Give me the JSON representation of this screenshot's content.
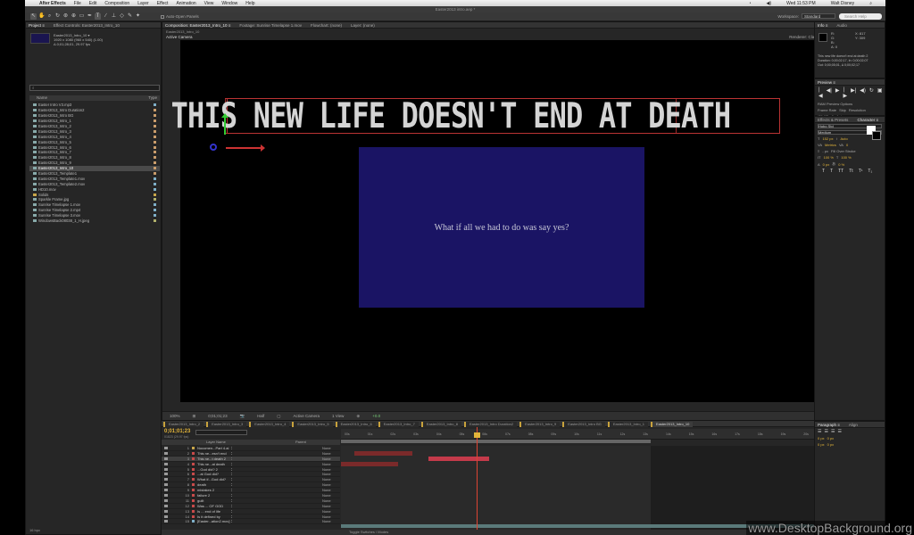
{
  "menubar": {
    "items": [
      "After Effects",
      "File",
      "Edit",
      "Composition",
      "Layer",
      "Effect",
      "Animation",
      "View",
      "Window",
      "Help"
    ],
    "clock": "Wed 11:53 PM",
    "user": "Walt Disney"
  },
  "window": {
    "title": "Easter2013 intro.aep *"
  },
  "toolbar": {
    "auto_open_label": "Auto-Open Panels",
    "workspace_label": "Workspace:",
    "workspace_value": "Standard",
    "help_placeholder": "Search Help"
  },
  "project": {
    "tabs": [
      "Project ≡",
      "Effect Controls: Easter2013_Intro_10"
    ],
    "selected_name": "Easter2013_Intro_10 ▾",
    "selected_info": "1920 x 1080 (960 x 540) (1.00)\nΔ 0;01;28;01, 29.97 fps",
    "column_name": "Name",
    "column_type": "Type",
    "items": [
      {
        "name": "Easter Intro V3.mp3",
        "label": "#7fb0c9"
      },
      {
        "name": "Easter2013_Intro Duration2",
        "label": "#c99c6b"
      },
      {
        "name": "Easter2013_Intro BG",
        "label": "#c99c6b"
      },
      {
        "name": "Easter2013_Intro_1",
        "label": "#c99c6b"
      },
      {
        "name": "Easter2013_Intro_2",
        "label": "#c99c6b"
      },
      {
        "name": "Easter2013_Intro_3",
        "label": "#c99c6b"
      },
      {
        "name": "Easter2013_Intro_4",
        "label": "#c99c6b"
      },
      {
        "name": "Easter2013_Intro_5",
        "label": "#c99c6b"
      },
      {
        "name": "Easter2013_Intro_6",
        "label": "#c99c6b"
      },
      {
        "name": "Easter2013_Intro_7",
        "label": "#c99c6b"
      },
      {
        "name": "Easter2013_Intro_8",
        "label": "#c99c6b"
      },
      {
        "name": "Easter2013_Intro_9",
        "label": "#c99c6b"
      },
      {
        "name": "Easter2013_Intro_10",
        "label": "#c99c6b",
        "selected": true
      },
      {
        "name": "Easter2013_Template1",
        "label": "#c99c6b"
      },
      {
        "name": "Easter2013_Template1.mov",
        "label": "#7fb0c9"
      },
      {
        "name": "Easter2013_Template2.mov",
        "label": "#7fb0c9"
      },
      {
        "name": "HD10.mov",
        "label": "#7fb0c9"
      },
      {
        "name": "Solids",
        "label": "#c9a64a",
        "folder": true
      },
      {
        "name": "Sparkle Frame.jpg",
        "label": "#b0b06b"
      },
      {
        "name": "Sunrise Timelapse 1.mov",
        "label": "#7fb0c9"
      },
      {
        "name": "Sunrise Timelapse 2.mp4",
        "label": "#7fb0c9"
      },
      {
        "name": "Sunrise Timelapse 3.mov",
        "label": "#7fb0c9"
      },
      {
        "name": "WindowsBack08038_1_H.jpeg",
        "label": "#b0b06b"
      }
    ],
    "footer_bpc": "16 bpc"
  },
  "composition": {
    "tabs": [
      "Composition: Easter2013_Intro_10 ≡",
      "Footage: Sunrise Timelapse 1.mov",
      "Flowchart: (none)",
      "Layer: (none)"
    ],
    "crumb": "Easter2013_Intro_10",
    "active_camera": "Active Camera",
    "renderer": "Renderer:  Classic 3D",
    "headline": "THIS NEW LIFE DOESN'T END AT DEATH",
    "slide_text": "What if all we had to do was say yes?",
    "slide_color": "#1a1464",
    "footer": [
      "100%",
      "⊞",
      "0;01;01;23",
      "📷",
      "Half",
      "▢",
      "Active Camera",
      "1 View",
      "⊕",
      "+0.0"
    ]
  },
  "info": {
    "tabs": [
      "Info ≡",
      "Audio"
    ],
    "values": "R:\nG:\nB:\nA: 0",
    "coords": "X: 817\nY: 309",
    "note": "This new life doesn't end at death 2\nDuration: 0;00;02;17, In: 0;00;02;07\nOut: 0;00;05;01, Δ 0;00;02;17"
  },
  "preview": {
    "title": "Preview ≡",
    "transport": [
      "|◀",
      "◀|",
      "▶",
      "|▶",
      "▶|",
      "◀)",
      "↻",
      "▣"
    ],
    "ram_options": "RAM Preview Options",
    "frame_rate_label": "Frame Rate",
    "skip_label": "Skip",
    "resolution_label": "Resolution",
    "frame_rate": "(29.97)",
    "skip": "0",
    "resolution": "Auto",
    "from_current": "From Current Time",
    "full_screen": "Full Screen"
  },
  "character": {
    "tabs": [
      "Effects & Presets",
      "Character ≡"
    ],
    "font": "Hobo Std",
    "style": "Medium",
    "size": "152 px",
    "auto": "Auto",
    "metrics": "Metrics",
    "tracking": "0",
    "stroke": "- px",
    "stroke_mode": "Fill Over Stroke",
    "vscale": "100 %",
    "hscale": "100 %",
    "baseline": "0 px",
    "tsume": "0 %"
  },
  "paragraph": {
    "tabs": [
      "Paragraph ≡",
      "Align"
    ],
    "indent_l": "0 px",
    "indent_r": "0 px",
    "space_before": "0 px",
    "space_after": "0 px"
  },
  "timeline": {
    "tabs": [
      "Easter2013_Intro_2",
      "Easter2013_Intro_3",
      "Easter2013_Intro_4",
      "Easter2013_Intro_5",
      "Easter2013_Intro_6",
      "Easter2013_Intro_7",
      "Easter2013_Intro_8",
      "Easter2013_Intro Duration2",
      "Easter2013_Intro_9",
      "Easter2013_Intro BG",
      "Easter2013_Intro_1",
      "Easter2013_Intro_10"
    ],
    "active_tab": 11,
    "timecode": "0;01;01;23",
    "fps_note": "01823 (29.97 fps)",
    "header_name": "Layer Name",
    "header_parent": "Parent",
    "ruler": [
      "00s",
      "01s",
      "02s",
      "03s",
      "04s",
      "05s",
      "06s",
      "07s",
      "08s",
      "09s",
      "10s",
      "11s",
      "12s",
      "13s",
      "14s",
      "15s",
      "16s",
      "17s",
      "18s",
      "19s",
      "20s",
      "21s"
    ],
    "layers": [
      {
        "num": "1",
        "name": "Nocomen...Part 4.ai",
        "color": "#c9a64a",
        "parent": "None"
      },
      {
        "num": "2",
        "name": "This ne...esn't end",
        "color": "#c84a4a",
        "parent": "None"
      },
      {
        "num": "3",
        "name": "This ne...t death 2",
        "color": "#c84a4a",
        "parent": "None",
        "selected": true
      },
      {
        "num": "4",
        "name": "This ne...at death",
        "color": "#c84a4a",
        "parent": "None"
      },
      {
        "num": "5",
        "name": "...God did? 2",
        "color": "#c84a4a",
        "parent": "None"
      },
      {
        "num": "6",
        "name": "...at God did?",
        "color": "#c84a4a",
        "parent": "None"
      },
      {
        "num": "7",
        "name": "What if...God did?",
        "color": "#c84a4a",
        "parent": "None"
      },
      {
        "num": "8",
        "name": "death",
        "color": "#c84a4a",
        "parent": "None"
      },
      {
        "num": "9",
        "name": "mistakes 2",
        "color": "#c84a4a",
        "parent": "None"
      },
      {
        "num": "10",
        "name": "failure 2",
        "color": "#c84a4a",
        "parent": "None"
      },
      {
        "num": "11",
        "name": "guilt",
        "color": "#c84a4a",
        "parent": "None"
      },
      {
        "num": "12",
        "name": "Was ... OF GOD",
        "color": "#c84a4a",
        "parent": "None"
      },
      {
        "num": "13",
        "name": "Is ... end of life",
        "color": "#c84a4a",
        "parent": "None"
      },
      {
        "num": "14",
        "name": "Is it defined by",
        "color": "#c84a4a",
        "parent": "None"
      },
      {
        "num": "15",
        "name": "[Easter...ation2.mov]",
        "color": "#7fb0c9",
        "parent": "None"
      }
    ],
    "footer": "Toggle Switches / Modes"
  },
  "watermark": "www.DesktopBackground.org"
}
